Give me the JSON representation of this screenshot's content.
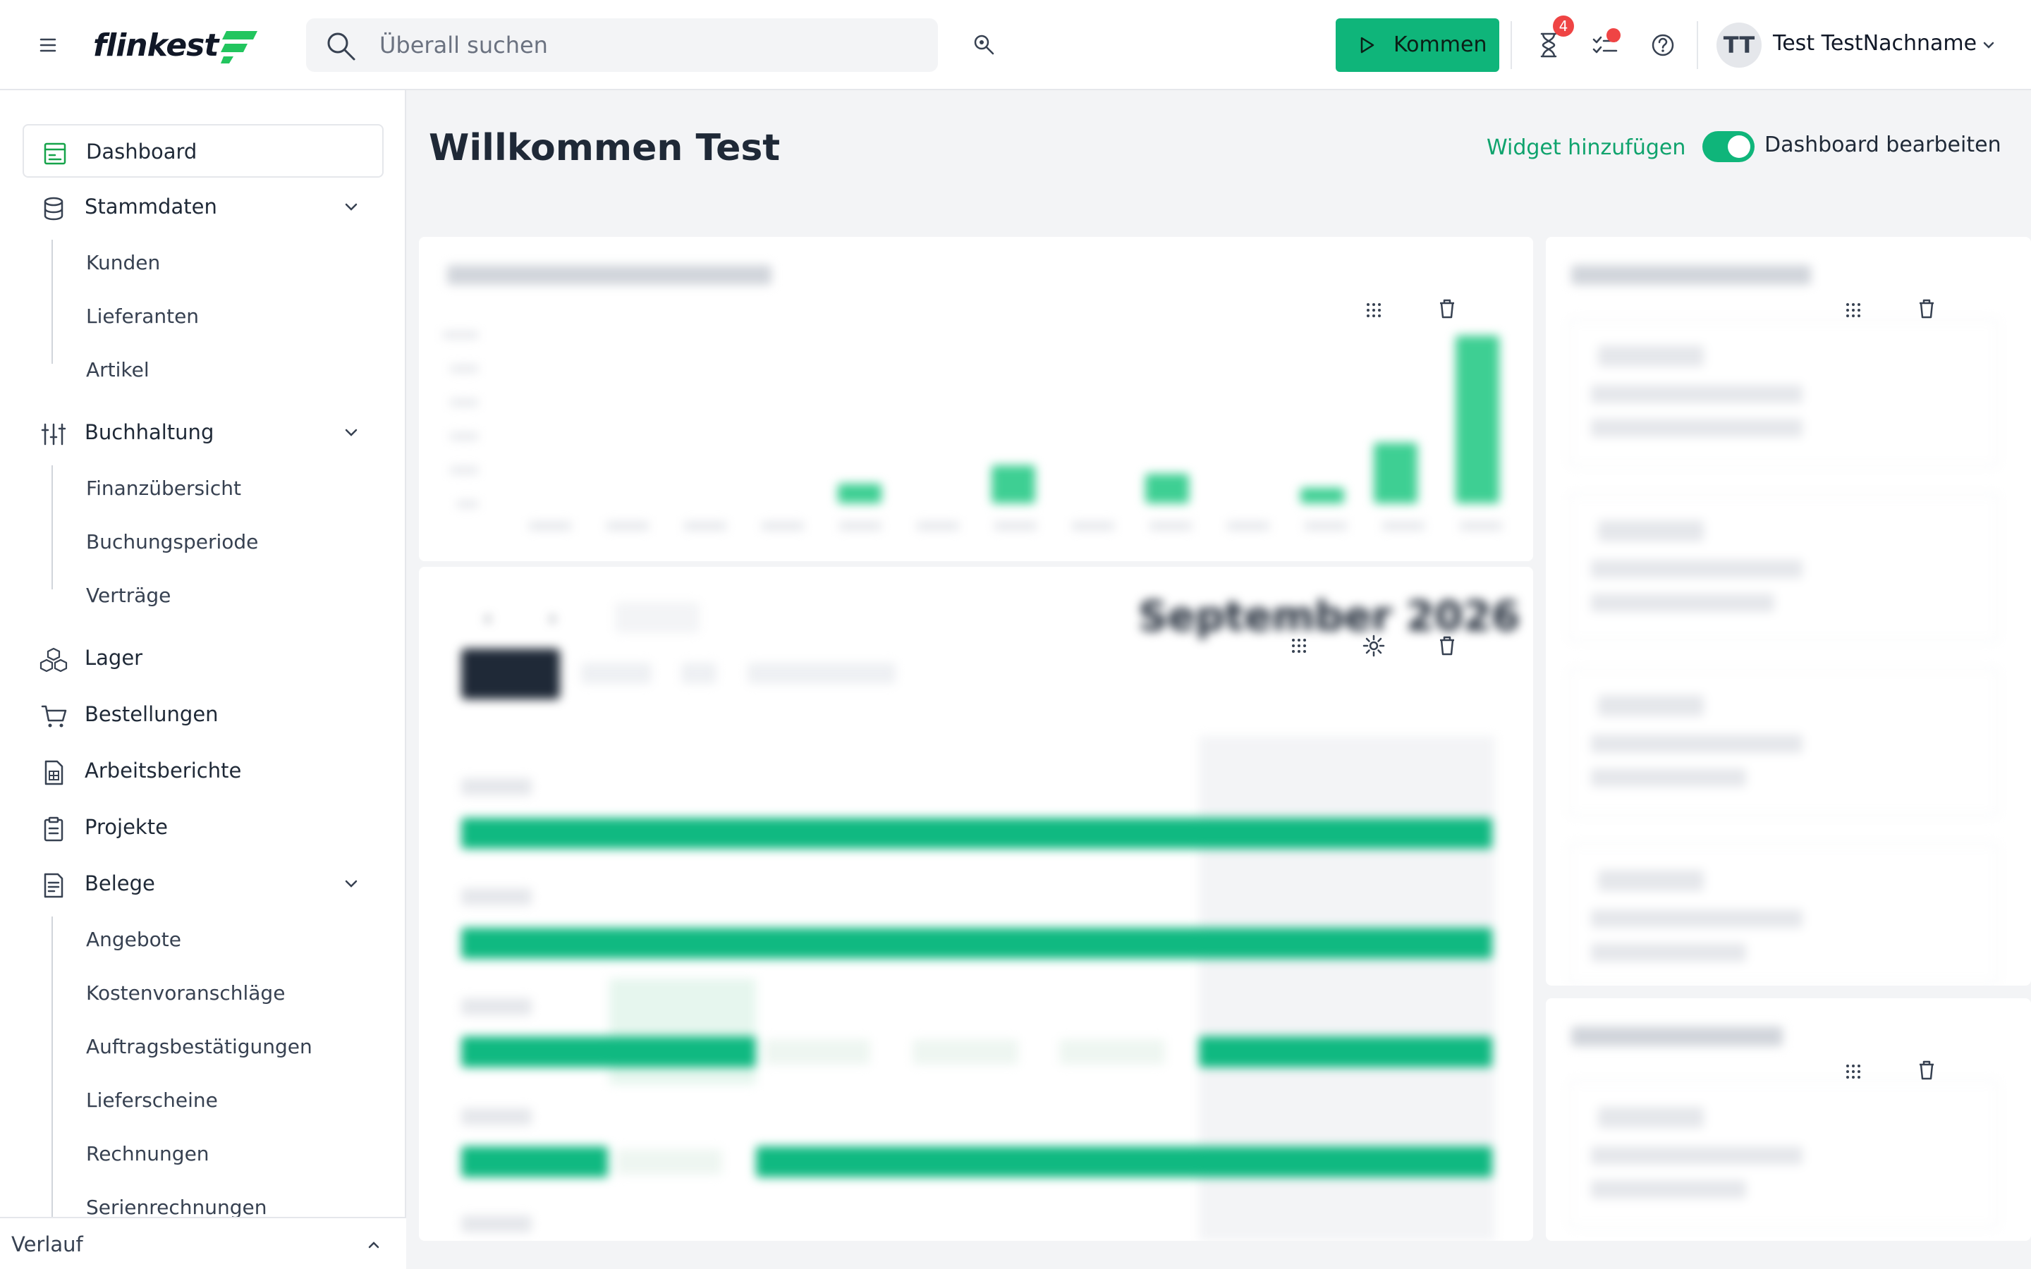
{
  "topbar": {
    "search_placeholder": "Überall suchen",
    "kommen_label": "Kommen",
    "notification_count": "4",
    "user_initials": "TT",
    "user_name": "Test TestNachname"
  },
  "sidebar": {
    "items": [
      {
        "label": "Dashboard",
        "icon": "dashboard-icon"
      },
      {
        "label": "Stammdaten",
        "icon": "database-icon"
      },
      {
        "label": "Buchhaltung",
        "icon": "sliders-icon"
      },
      {
        "label": "Lager",
        "icon": "boxes-icon"
      },
      {
        "label": "Bestellungen",
        "icon": "cart-icon"
      },
      {
        "label": "Arbeitsberichte",
        "icon": "report-icon"
      },
      {
        "label": "Projekte",
        "icon": "clipboard-icon"
      },
      {
        "label": "Belege",
        "icon": "receipt-icon"
      }
    ],
    "stammdaten_sub": [
      "Kunden",
      "Lieferanten",
      "Artikel"
    ],
    "buchhaltung_sub": [
      "Finanzübersicht",
      "Buchungsperiode",
      "Verträge"
    ],
    "belege_sub": [
      "Angebote",
      "Kostenvoranschläge",
      "Auftragsbestätigungen",
      "Lieferscheine",
      "Rechnungen",
      "Serienrechnungen"
    ],
    "footer_label": "Verlauf"
  },
  "main": {
    "title": "Willkommen Test",
    "add_widget": "Widget hinzufügen",
    "edit_dashboard": "Dashboard bearbeiten",
    "edit_enabled": true
  },
  "calendar": {
    "title": "September 2026"
  },
  "colors": {
    "accent": "#0fb57a",
    "accent_text": "#0fa36d",
    "badge": "#ef4444"
  }
}
